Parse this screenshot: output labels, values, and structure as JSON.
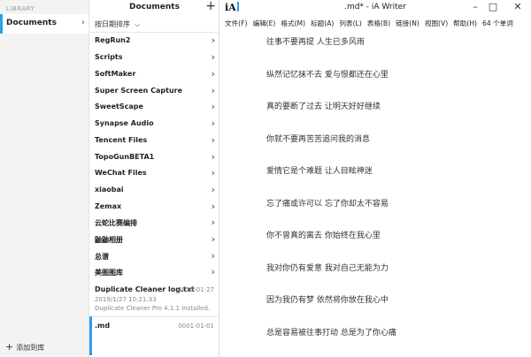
{
  "library": {
    "heading": "LIBRARY",
    "selected": "Documents",
    "add_label": "添加到库"
  },
  "files": {
    "title": "Documents",
    "sort_label": "按日期排序",
    "folders": [
      "RegRun2",
      "Scripts",
      "SoftMaker",
      "Super Screen Capture",
      "SweetScape",
      "Synapse Audio",
      "Tencent Files",
      "TopoGunBETA1",
      "WeChat Files",
      "xiaobai",
      "Zemax",
      "云蛇比赛编排",
      "鼬鼬相册",
      "总谱",
      "美图图库"
    ],
    "documents": [
      {
        "name": "Duplicate Cleaner log.txt",
        "date": "2019-01-27",
        "line1": "2019/1/27 10:21:33",
        "line2": "Duplicate Cleaner Pro 4.1.1 installed."
      },
      {
        "name": ".md",
        "date": "0001-01-01"
      }
    ]
  },
  "window": {
    "title": ".md* - iA Writer",
    "app_logo": "iA"
  },
  "menu": [
    "文件(F)",
    "编辑(E)",
    "格式(M)",
    "标题(A)",
    "列表(L)",
    "表格(B)",
    "链接(N)",
    "视图(V)",
    "帮助(H)",
    "64 个单词"
  ],
  "document": {
    "lines": [
      "往事不要再提  人生已多风雨",
      "纵然记忆抹不去  爱与恨都还在心里",
      "真的要断了过去  让明天好好继续",
      "你就不要再苦苦追问我的消息",
      "爱情它是个难题  让人目眩神迷",
      "忘了痛或许可以  忘了你却太不容易",
      "你不曾真的离去  你始终在我心里",
      "我对你仍有爱意  我对自己无能为力",
      "因为我仍有梦  依然将你放在我心中",
      "总是容易被往事打动  总是为了你心痛"
    ]
  },
  "colors": {
    "accent": "#2b9fe6"
  },
  "icons": {
    "add": "plus-icon",
    "chevron": "chevron-right-icon",
    "sort": "chevron-down-icon",
    "minimize": "minimize-icon",
    "maximize": "maximize-icon",
    "close": "close-icon"
  }
}
